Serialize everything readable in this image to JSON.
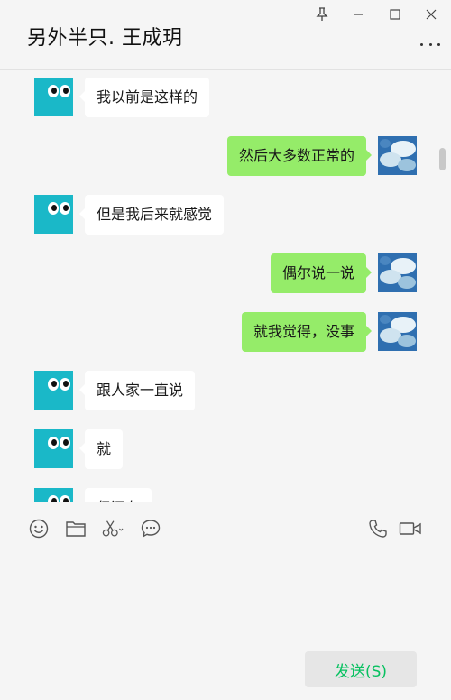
{
  "header": {
    "title": "另外半只. 王成玥",
    "controls": [
      "pin-icon",
      "minimize-icon",
      "maximize-icon",
      "close-icon"
    ],
    "more_icon": "more-icon"
  },
  "messages": [
    {
      "side": "left",
      "text": "我以前是这样的"
    },
    {
      "side": "right",
      "text": "然后大多数正常的"
    },
    {
      "side": "left",
      "text": "但是我后来就感觉"
    },
    {
      "side": "right",
      "text": "偶尔说一说"
    },
    {
      "side": "right",
      "text": "就我觉得，没事"
    },
    {
      "side": "left",
      "text": "跟人家一直说"
    },
    {
      "side": "left",
      "text": "就"
    },
    {
      "side": "left",
      "text": "但还有"
    }
  ],
  "toolbar": {
    "icons": [
      "emoji-icon",
      "folder-icon",
      "scissors-icon",
      "chat-bubble-icon",
      "phone-icon",
      "video-call-icon"
    ]
  },
  "input": {
    "value": ""
  },
  "send_button": {
    "label": "发送(S)"
  },
  "colors": {
    "sent_bubble": "#95ec69",
    "received_bubble": "#ffffff",
    "accent": "#07c160",
    "avatar_teal": "#1ab8c8"
  }
}
